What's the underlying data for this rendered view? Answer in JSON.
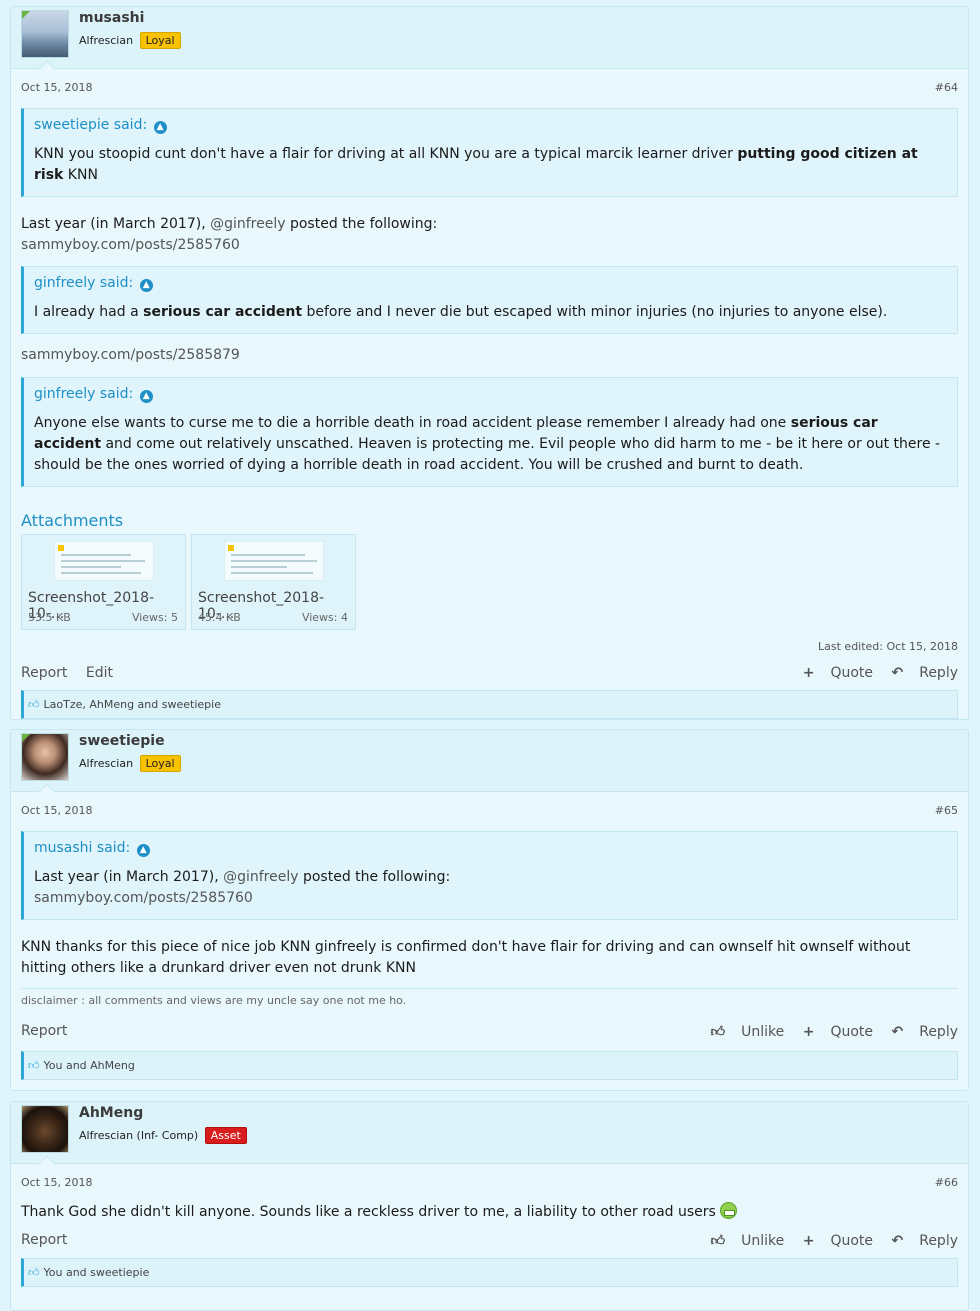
{
  "posts": [
    {
      "username": "musashi",
      "user_title": "Alfrescian",
      "badge": "Loyal",
      "date": "Oct 15, 2018",
      "post_number": "#64",
      "quote1": {
        "author": "sweetiepie said:",
        "text_a": "KNN you stoopid cunt don't have a flair for driving at all KNN you are a typical marcik learner driver ",
        "text_bold": "putting good citizen at risk",
        "text_b": " KNN"
      },
      "line1_a": "Last year (in March 2017), ",
      "line1_mention": "@ginfreely",
      "line1_b": " posted the following:",
      "link1": "sammyboy.com/posts/2585760",
      "quote2": {
        "author": "ginfreely said:",
        "text_a": "I already had a ",
        "text_bold": "serious car accident",
        "text_b": " before and I never die but escaped with minor injuries (no injuries to anyone else)."
      },
      "link2": "sammyboy.com/posts/2585879",
      "quote3": {
        "author": "ginfreely said:",
        "text_a": "Anyone else wants to curse me to die a horrible death in road accident please remember I already had one ",
        "text_bold": "serious car accident",
        "text_b": " and come out relatively unscathed. Heaven is protecting me. Evil people who did harm to me - be it here or out there - should be the ones worried of dying a horrible death in road accident. You will be crushed and burnt to death."
      },
      "attachments_title": "Attachments",
      "attachments": [
        {
          "name": "Screenshot_2018-10-...",
          "size": "53.5 KB",
          "views": "Views: 5"
        },
        {
          "name": "Screenshot_2018-10-...",
          "size": "45.4 KB",
          "views": "Views: 4"
        }
      ],
      "last_edited": "Last edited: Oct 15, 2018",
      "actions_left": [
        "Report",
        "Edit"
      ],
      "actions_right": [
        "Quote",
        "Reply"
      ],
      "likes": "LaoTze, AhMeng and sweetiepie"
    },
    {
      "username": "sweetiepie",
      "user_title": "Alfrescian",
      "badge": "Loyal",
      "date": "Oct 15, 2018",
      "post_number": "#65",
      "quote1": {
        "author": "musashi said:",
        "line_a": "Last year (in March 2017), ",
        "mention": "@ginfreely",
        "line_b": " posted the following:",
        "link": "sammyboy.com/posts/2585760"
      },
      "text": "KNN thanks for this piece of nice job KNN ginfreely is confirmed don't have flair for driving and can ownself hit ownself without hitting others like a drunkard driver even not drunk KNN",
      "signature": "disclaimer : all comments and views are my uncle say one not me ho.",
      "actions_left": [
        "Report"
      ],
      "actions_right": [
        "Unlike",
        "Quote",
        "Reply"
      ],
      "likes": "You and AhMeng"
    },
    {
      "username": "AhMeng",
      "user_title": "Alfrescian (Inf- Comp)",
      "badge": "Asset",
      "date": "Oct 15, 2018",
      "post_number": "#66",
      "text": "Thank God she didn't kill anyone. Sounds like a reckless driver to me, a liability to other road users",
      "emoji": "grin-emoji",
      "actions_left": [
        "Report"
      ],
      "actions_right": [
        "Unlike",
        "Quote",
        "Reply"
      ],
      "likes": "You and sweetiepie"
    }
  ],
  "colors": {
    "accent": "#2ea7d8",
    "background": "#dff4fb",
    "loyal_badge": "#f8c200",
    "asset_badge": "#d91c1c"
  }
}
